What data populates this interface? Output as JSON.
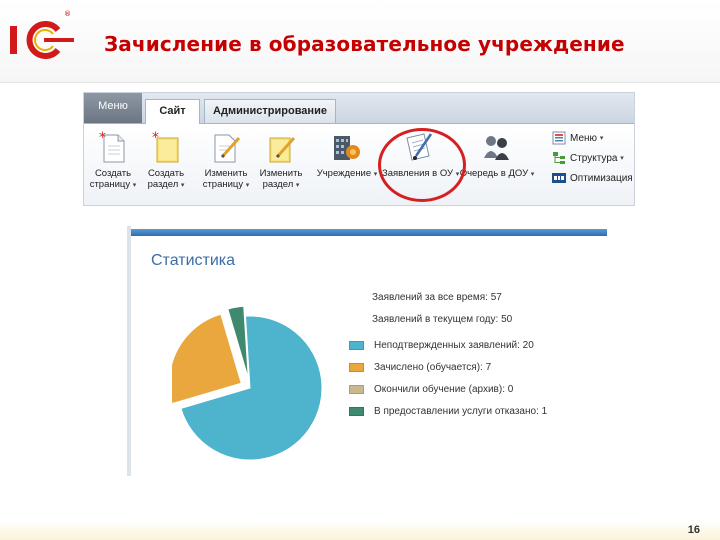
{
  "slide": {
    "title": "Зачисление в образовательное учреждение",
    "page_number": "16",
    "logo_text": "1С",
    "logo_reg": "®"
  },
  "ribbon": {
    "tabs": [
      {
        "label": "Меню",
        "active": false
      },
      {
        "label": "Сайт",
        "active": true
      },
      {
        "label": "Администрирование",
        "active": false
      }
    ],
    "buttons": [
      {
        "line1": "Создать",
        "line2": "страницу",
        "icon": "new-page-icon"
      },
      {
        "line1": "Создать",
        "line2": "раздел",
        "icon": "new-folder-icon"
      },
      {
        "line1": "Изменить",
        "line2": "страницу",
        "icon": "edit-page-icon"
      },
      {
        "line1": "Изменить",
        "line2": "раздел",
        "icon": "edit-folder-icon"
      },
      {
        "line1": "Учреждение",
        "line2": "",
        "icon": "institution-icon"
      },
      {
        "line1": "Заявления в ОУ",
        "line2": "",
        "icon": "applications-icon"
      },
      {
        "line1": "Очередь в ДОУ",
        "line2": "",
        "icon": "queue-icon"
      }
    ],
    "small_items": [
      {
        "label": "Меню",
        "icon": "menu-icon"
      },
      {
        "label": "Структура",
        "icon": "structure-icon"
      },
      {
        "label": "Оптимизация",
        "icon": "seo-icon"
      }
    ],
    "dropdown_arrow": "▾"
  },
  "stats": {
    "title": "Статистика",
    "total_line": "Заявлений за все время: 57",
    "current_year_line": "Заявлений в текущем году: 50",
    "legend": [
      {
        "label": "Неподтвержденных заявлений: 20",
        "color": "#4eb3cc"
      },
      {
        "label": "Зачислено (обучается): 7",
        "color": "#e9a73d"
      },
      {
        "label": "Окончили обучение (архив): 0",
        "color": "#cbb98d"
      },
      {
        "label": "В предоставлении услуги отказано: 1",
        "color": "#3f8a6e"
      }
    ],
    "pie_values": [
      20,
      7,
      0,
      1
    ]
  }
}
